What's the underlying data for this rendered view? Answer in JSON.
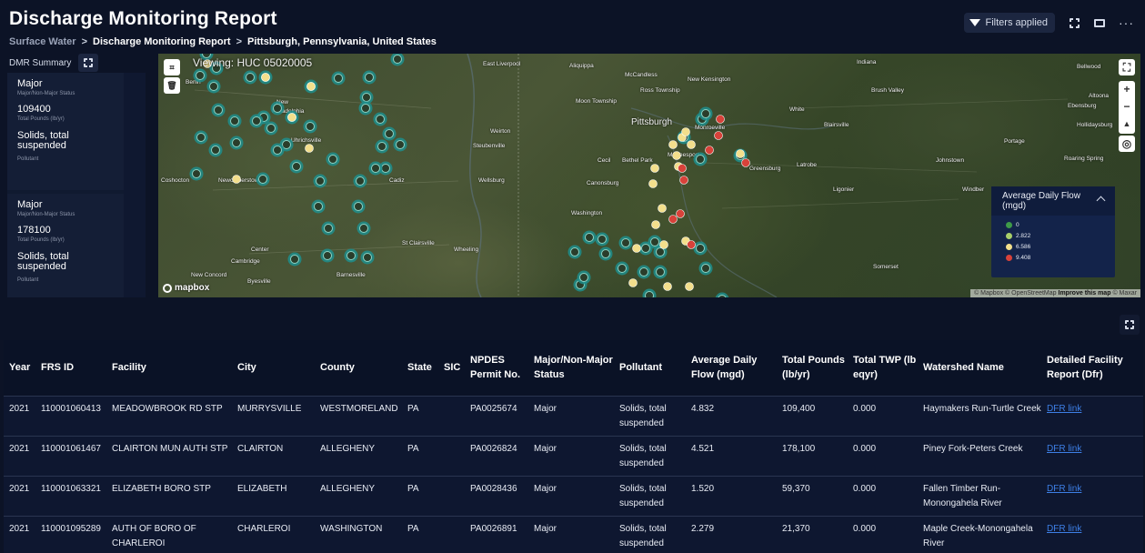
{
  "header": {
    "title": "Discharge Monitoring Report",
    "breadcrumb": [
      "Surface Water",
      "Discharge Monitoring Report",
      "Pittsburgh, Pennsylvania, United States"
    ],
    "breadcrumb_sep": ">",
    "filters_label": "Filters applied"
  },
  "summary": {
    "label": "DMR Summary",
    "cards": [
      {
        "status": "Major",
        "status_caption": "Major/Non-Major Status",
        "value": "109400",
        "value_caption": "Total Pounds (lb/yr)",
        "pollutant": "Solids, total suspended",
        "pollutant_caption": "Pollutant"
      },
      {
        "status": "Major",
        "status_caption": "Major/Non-Major Status",
        "value": "178100",
        "value_caption": "Total Pounds (lb/yr)",
        "pollutant": "Solids, total suspended",
        "pollutant_caption": "Pollutant"
      }
    ]
  },
  "map": {
    "viewing": "Viewing: HUC 05020005",
    "places": [
      {
        "name": "Berlin",
        "cls": "small"
      },
      {
        "name": "New",
        "cls": "small"
      },
      {
        "name": "Philadelphia",
        "cls": "small"
      },
      {
        "name": "Uhrichsville",
        "cls": "small"
      },
      {
        "name": "Coshocton",
        "cls": "small"
      },
      {
        "name": "Newcomerstown",
        "cls": "small"
      },
      {
        "name": "Cadiz",
        "cls": "small"
      },
      {
        "name": "Center",
        "cls": "small"
      },
      {
        "name": "Cambridge",
        "cls": "small"
      },
      {
        "name": "New Concord",
        "cls": "small"
      },
      {
        "name": "Byesville",
        "cls": "small"
      },
      {
        "name": "Barnesville",
        "cls": "small"
      },
      {
        "name": "St Clairsville",
        "cls": "small"
      },
      {
        "name": "Wheeling",
        "cls": "small"
      },
      {
        "name": "East Liverpool",
        "cls": "small"
      },
      {
        "name": "Weirton",
        "cls": "small"
      },
      {
        "name": "Steubenville",
        "cls": "small"
      },
      {
        "name": "Wellsburg",
        "cls": "small"
      },
      {
        "name": "Aliquippa",
        "cls": "small"
      },
      {
        "name": "McCandless",
        "cls": "small"
      },
      {
        "name": "Ross Township",
        "cls": "small"
      },
      {
        "name": "Moon Township",
        "cls": "small"
      },
      {
        "name": "New Kensington",
        "cls": "small"
      },
      {
        "name": "Pittsburgh",
        "cls": "city"
      },
      {
        "name": "Monroeville",
        "cls": "small"
      },
      {
        "name": "Cecil",
        "cls": "small"
      },
      {
        "name": "Bethel Park",
        "cls": "small"
      },
      {
        "name": "McKeesport",
        "cls": "small"
      },
      {
        "name": "Canonsburg",
        "cls": "small"
      },
      {
        "name": "Washington",
        "cls": "small"
      },
      {
        "name": "Greensburg",
        "cls": "small"
      },
      {
        "name": "Latrobe",
        "cls": "small"
      },
      {
        "name": "White",
        "cls": "small"
      },
      {
        "name": "Indiana",
        "cls": "small"
      },
      {
        "name": "Brush Valley",
        "cls": "small"
      },
      {
        "name": "Blairsville",
        "cls": "small"
      },
      {
        "name": "Ligonier",
        "cls": "small"
      },
      {
        "name": "Johnstown",
        "cls": "small"
      },
      {
        "name": "Windber",
        "cls": "small"
      },
      {
        "name": "Ebensburg",
        "cls": "small"
      },
      {
        "name": "Portage",
        "cls": "small"
      },
      {
        "name": "Altoona",
        "cls": "small"
      },
      {
        "name": "Bellwood",
        "cls": "small"
      },
      {
        "name": "Hollidaysburg",
        "cls": "small"
      },
      {
        "name": "Roaring Spring",
        "cls": "small"
      },
      {
        "name": "Somerset",
        "cls": "small"
      }
    ],
    "legend": {
      "title": "Average Daily Flow (mgd)",
      "items": [
        {
          "label": "0",
          "color": "#3e9a48"
        },
        {
          "label": "2.822",
          "color": "#a8cf6a"
        },
        {
          "label": "6.586",
          "color": "#f3df8c"
        },
        {
          "label": "9.408",
          "color": "#d8423a"
        }
      ]
    },
    "logo": "mapbox",
    "attribution": {
      "a": "© Mapbox",
      "b": "© OpenStreetMap",
      "c": "Improve this map",
      "d": "© Maxar"
    }
  },
  "table": {
    "columns": [
      "Year",
      "FRS ID",
      "Facility",
      "City",
      "County",
      "State",
      "SIC",
      "NPDES Permit No.",
      "Major/Non-Major Status",
      "Pollutant",
      "Average Daily Flow (mgd)",
      "Total Pounds (lb/yr)",
      "Total TWP (lb eqyr)",
      "Watershed Name",
      "Detailed Facility Report (Dfr)"
    ],
    "rows": [
      {
        "year": "2021",
        "frs_id": "110001060413",
        "facility": "MEADOWBROOK RD STP",
        "city": "MURRYSVILLE",
        "county": "WESTMORELAND",
        "state": "PA",
        "sic": "",
        "npdes": "PA0025674",
        "status": "Major",
        "pollutant": "Solids, total suspended",
        "flow": "4.832",
        "pounds": "109,400",
        "twp": "0.000",
        "watershed": "Haymakers Run-Turtle Creek",
        "dfr": "DFR link"
      },
      {
        "year": "2021",
        "frs_id": "110001061467",
        "facility": "CLAIRTON MUN AUTH STP",
        "city": "CLAIRTON",
        "county": "ALLEGHENY",
        "state": "PA",
        "sic": "",
        "npdes": "PA0026824",
        "status": "Major",
        "pollutant": "Solids, total suspended",
        "flow": "4.521",
        "pounds": "178,100",
        "twp": "0.000",
        "watershed": "Piney Fork-Peters Creek",
        "dfr": "DFR link"
      },
      {
        "year": "2021",
        "frs_id": "110001063321",
        "facility": "ELIZABETH BORO STP",
        "city": "ELIZABETH",
        "county": "ALLEGHENY",
        "state": "PA",
        "sic": "",
        "npdes": "PA0028436",
        "status": "Major",
        "pollutant": "Solids, total suspended",
        "flow": "1.520",
        "pounds": "59,370",
        "twp": "0.000",
        "watershed": "Fallen Timber Run-Monongahela River",
        "dfr": "DFR link"
      },
      {
        "year": "2021",
        "frs_id": "110001095289",
        "facility": "AUTH OF BORO OF CHARLEROI",
        "city": "CHARLEROI",
        "county": "WASHINGTON",
        "state": "PA",
        "sic": "",
        "npdes": "PA0026891",
        "status": "Major",
        "pollutant": "Solids, total suspended",
        "flow": "2.279",
        "pounds": "21,370",
        "twp": "0.000",
        "watershed": "Maple Creek-Monongahela River",
        "dfr": "DFR link"
      }
    ]
  }
}
